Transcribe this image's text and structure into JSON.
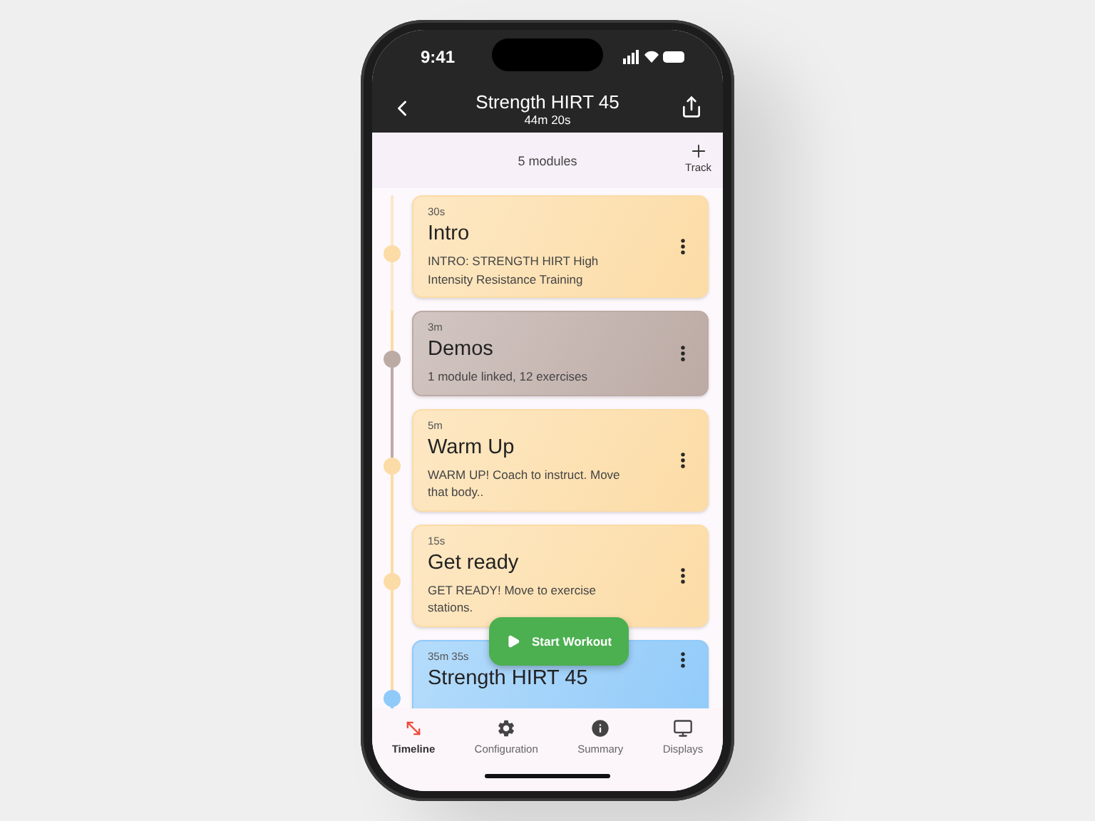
{
  "status_bar": {
    "time": "9:41"
  },
  "header": {
    "title": "Strength HIRT 45",
    "subtitle": "44m 20s"
  },
  "toolbar": {
    "count": "5 modules",
    "add_label": "Track"
  },
  "modules": [
    {
      "duration": "30s",
      "title": "Intro",
      "description": "INTRO: STRENGTH HIRT High Intensity Resistance Training",
      "color": "#fcdca6"
    },
    {
      "duration": "3m",
      "title": "Demos",
      "description": "1 module linked, 12 exercises",
      "color": "#bcaaa4"
    },
    {
      "duration": "5m",
      "title": "Warm Up",
      "description": "WARM UP! Coach to instruct. Move that body..",
      "color": "#fcdca6"
    },
    {
      "duration": "15s",
      "title": "Get ready",
      "description": "GET READY! Move to exercise stations.",
      "color": "#fcdca6"
    },
    {
      "duration": "35m 35s",
      "title": "Strength HIRT 45",
      "color": "#90caf9"
    }
  ],
  "start_button": "Start Workout",
  "nav": [
    {
      "kind": "timeline",
      "label": "Timeline",
      "selected": true
    },
    {
      "kind": "settings",
      "label": "Configuration",
      "selected": false
    },
    {
      "kind": "info",
      "label": "Summary",
      "selected": false
    },
    {
      "kind": "display",
      "label": "Displays",
      "selected": false
    }
  ]
}
